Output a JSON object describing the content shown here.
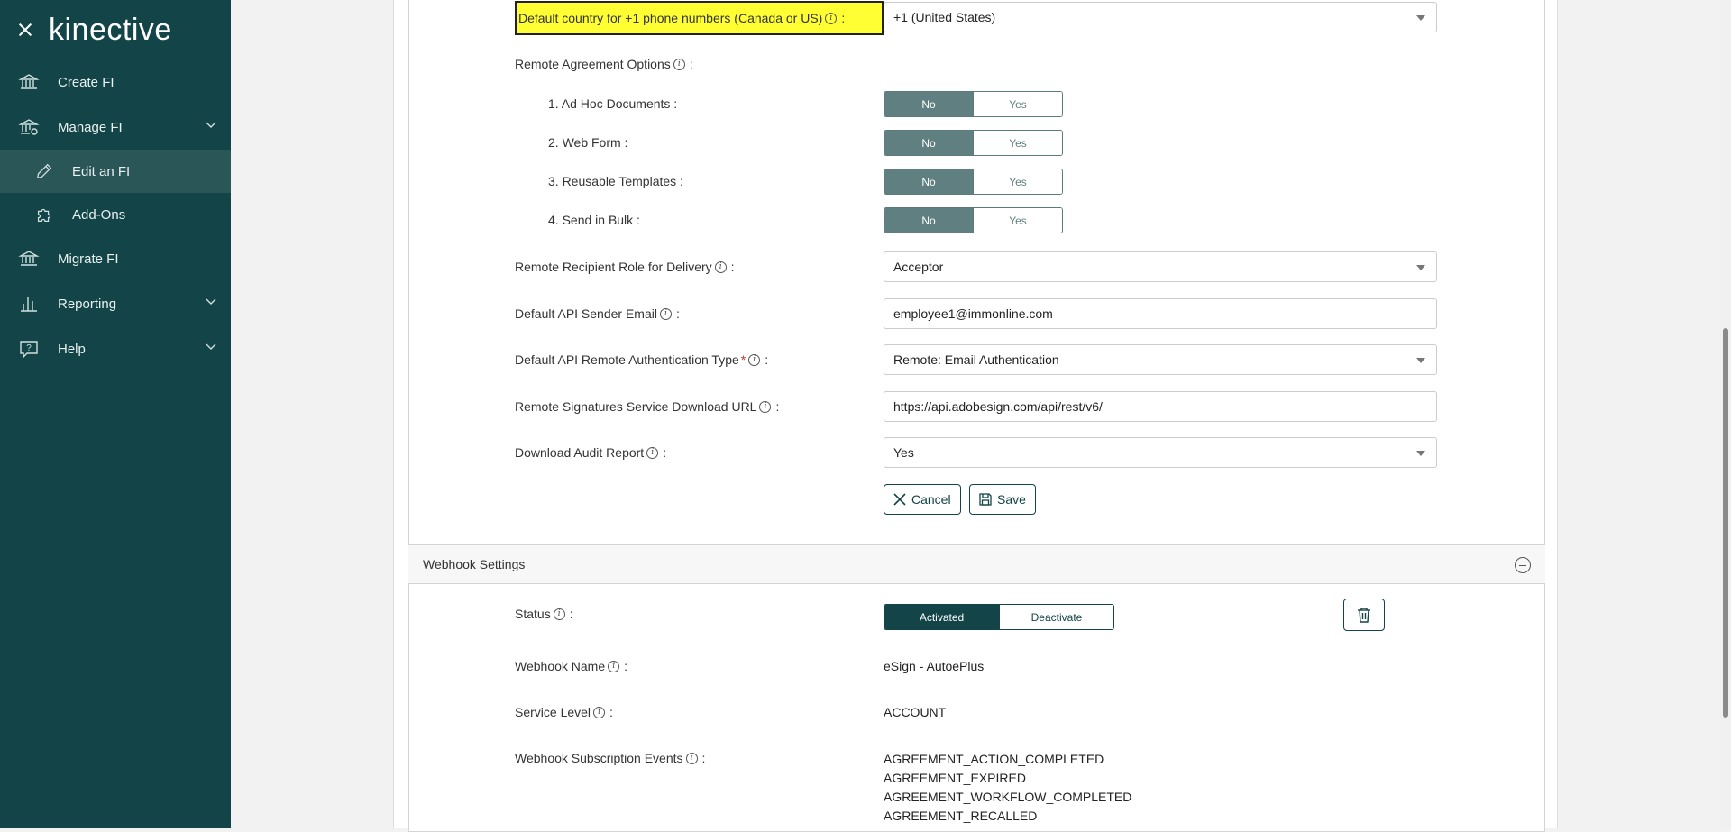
{
  "sidebar": {
    "logo": "kinective",
    "items": [
      {
        "label": "Create FI"
      },
      {
        "label": "Manage FI"
      },
      {
        "label": "Edit an FI"
      },
      {
        "label": "Add-Ons"
      },
      {
        "label": "Migrate FI"
      },
      {
        "label": "Reporting"
      },
      {
        "label": "Help"
      }
    ]
  },
  "form": {
    "default_country_label": "Default country for +1 phone numbers (Canada or US)",
    "default_country_value": "+1 (United States)",
    "remote_agreement_label": "Remote Agreement Options",
    "options": [
      {
        "label": "1. Ad Hoc Documents :",
        "no": "No",
        "yes": "Yes"
      },
      {
        "label": "2. Web Form :",
        "no": "No",
        "yes": "Yes"
      },
      {
        "label": "3. Reusable Templates :",
        "no": "No",
        "yes": "Yes"
      },
      {
        "label": "4. Send in Bulk :",
        "no": "No",
        "yes": "Yes"
      }
    ],
    "recipient_role_label": "Remote Recipient Role for Delivery",
    "recipient_role_value": "Acceptor",
    "sender_email_label": "Default API Sender Email",
    "sender_email_value": "employee1@immonline.com",
    "auth_type_label": "Default API Remote Authentication Type",
    "auth_type_value": "Remote: Email Authentication",
    "download_url_label": "Remote Signatures Service Download URL",
    "download_url_value": "https://api.adobesign.com/api/rest/v6/",
    "audit_report_label": "Download Audit Report",
    "audit_report_value": "Yes",
    "cancel_label": "Cancel",
    "save_label": "Save"
  },
  "webhook": {
    "title": "Webhook Settings",
    "status_label": "Status",
    "activated": "Activated",
    "deactivate": "Deactivate",
    "name_label": "Webhook Name",
    "name_value": "eSign - AutoePlus",
    "service_level_label": "Service Level",
    "service_level_value": "ACCOUNT",
    "events_label": "Webhook Subscription Events",
    "events": [
      "AGREEMENT_ACTION_COMPLETED",
      "AGREEMENT_EXPIRED",
      "AGREEMENT_WORKFLOW_COMPLETED",
      "AGREEMENT_RECALLED"
    ]
  },
  "colors": {
    "sidebar_bg": "#134447",
    "highlight": "#ffff33",
    "toggle_on": "#5f7f81"
  }
}
